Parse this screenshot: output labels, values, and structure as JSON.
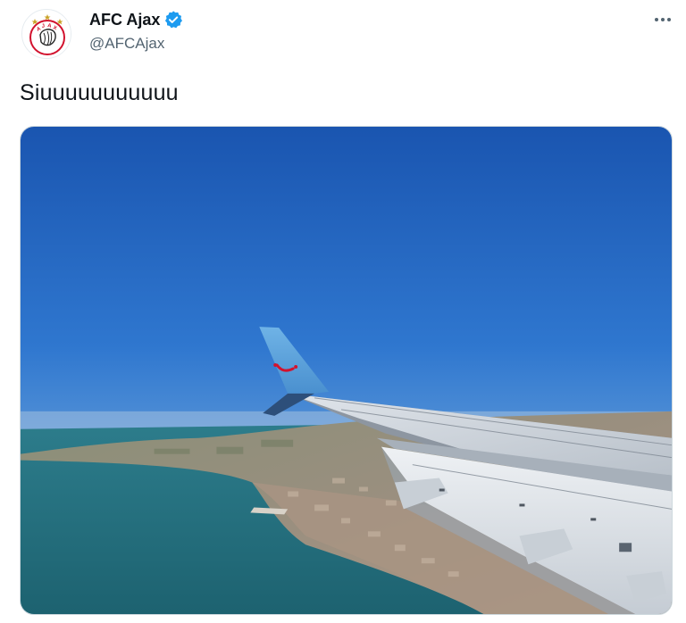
{
  "tweet": {
    "author": {
      "display_name": "AFC Ajax",
      "handle": "@AFCAjax",
      "avatar_icon": "ajax-crest-icon",
      "verified_icon": "verified-badge-icon",
      "verified_color": "#1d9bf0"
    },
    "text": "Siuuuuuuuuuuu",
    "more_icon": "more-options-icon",
    "media": {
      "type": "photo",
      "subject_icon": "airplane-wing-photo"
    }
  },
  "colors": {
    "brand_red": "#d2122e",
    "text_primary": "#0f1419",
    "text_secondary": "#536471"
  }
}
